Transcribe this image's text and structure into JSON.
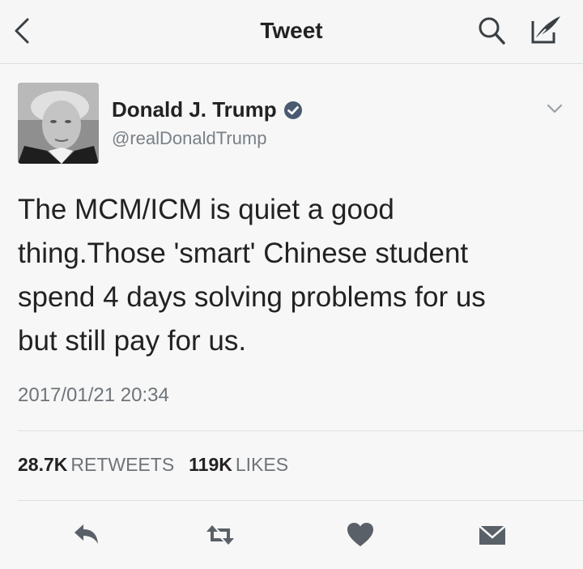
{
  "nav": {
    "title": "Tweet"
  },
  "author": {
    "name": "Donald J. Trump",
    "handle": "@realDonaldTrump",
    "verified": true
  },
  "tweet": {
    "lines": [
      "The MCM/ICM is quiet a good",
      "thing.Those 'smart' Chinese student",
      "spend 4 days solving problems for us",
      "but still pay for us."
    ],
    "timestamp": "2017/01/21 20:34"
  },
  "stats": {
    "retweets_count": "28.7K",
    "retweets_label": "RETWEETS",
    "likes_count": "119K",
    "likes_label": "LIKES"
  },
  "icons": {
    "back": "chevron-left-icon",
    "search": "search-icon",
    "compose": "compose-icon",
    "verified": "verified-badge-icon",
    "more": "chevron-down-icon",
    "reply": "reply-icon",
    "retweet": "retweet-icon",
    "like": "heart-icon",
    "message": "envelope-icon"
  },
  "colors": {
    "accent": "#1da1f2",
    "icon_gray": "#6f747a"
  }
}
